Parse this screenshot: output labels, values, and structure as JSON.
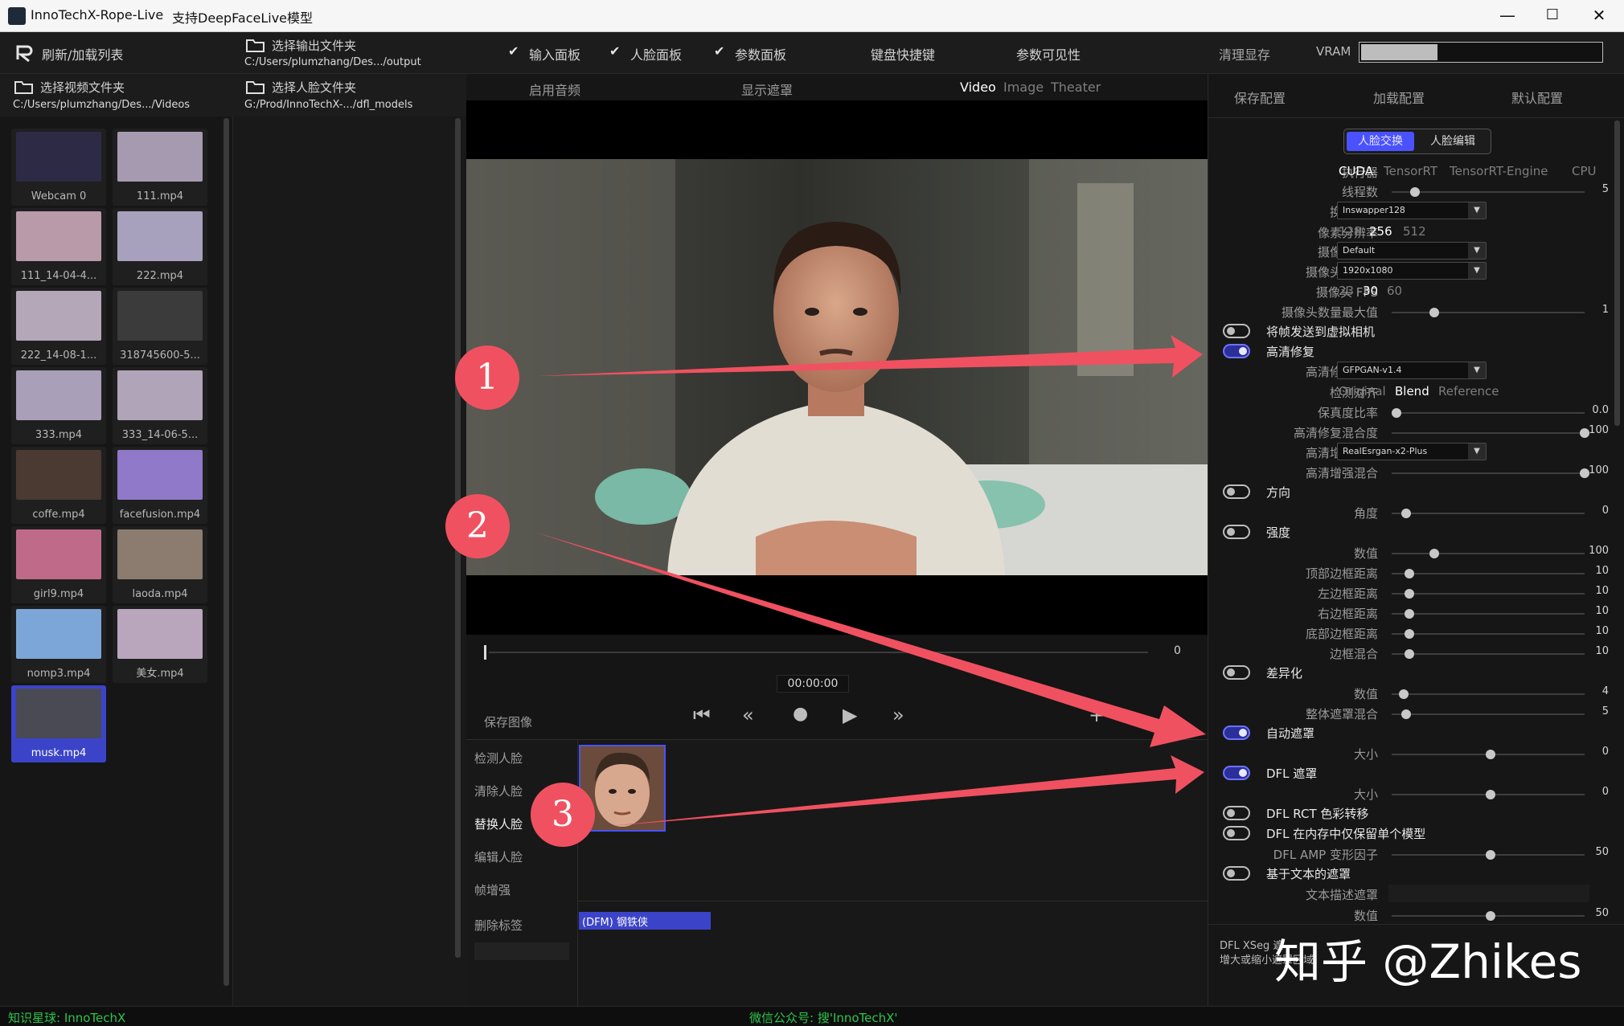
{
  "window": {
    "title": "InnoTechX-Rope-Live",
    "subtitle": "支持DeepFaceLive模型",
    "minimize": "—",
    "maximize": "☐",
    "close": "✕"
  },
  "toolbar": {
    "refresh_label": "刷新/加载列表",
    "select_output_label": "选择输出文件夹",
    "output_path": "C:/Users/plumzhang/Des.../output",
    "input_panel": "输入面板",
    "face_panel": "人脸面板",
    "param_panel": "参数面板",
    "shortcuts": "键盘快捷键",
    "param_visibility": "参数可见性",
    "clear_vram": "清理显存",
    "vram_label": "VRAM",
    "vram_fraction": 0.32
  },
  "left": {
    "select_video_label": "选择视频文件夹",
    "video_path": "C:/Users/plumzhang/Des.../Videos",
    "select_face_label": "选择人脸文件夹",
    "face_path": "G:/Prod/InnoTechX-.../dfl_models",
    "thumbnails": [
      {
        "label": "Webcam 0"
      },
      {
        "label": "111.mp4"
      },
      {
        "label": "111_14-04-4..."
      },
      {
        "label": "222.mp4"
      },
      {
        "label": "222_14-08-1..."
      },
      {
        "label": "318745600-5..."
      },
      {
        "label": "333.mp4"
      },
      {
        "label": "333_14-06-5..."
      },
      {
        "label": "coffe.mp4"
      },
      {
        "label": "facefusion.mp4"
      },
      {
        "label": "girl9.mp4"
      },
      {
        "label": "laoda.mp4"
      },
      {
        "label": "nomp3.mp4"
      },
      {
        "label": "美女.mp4"
      },
      {
        "label": "musk.mp4"
      }
    ]
  },
  "video": {
    "enable_audio": "启用音频",
    "show_mask": "显示遮罩",
    "tab_video": "Video",
    "tab_image": "Image",
    "tab_theater": "Theater",
    "frame_count": "0",
    "timecode": "00:00:00",
    "save_image": "保存图像",
    "plus": "+",
    "minus": "−"
  },
  "facepanel": {
    "detect": "检测人脸",
    "clear": "清除人脸",
    "swap": "替换人脸",
    "edit": "编辑人脸",
    "enhance": "帧增强",
    "delete_tag": "删除标签",
    "model_tag": "(DFM) 钢铁侠"
  },
  "right": {
    "save_config": "保存配置",
    "load_config": "加载配置",
    "default_config": "默认配置",
    "tab_swap": "人脸交换",
    "tab_edit": "人脸编辑",
    "executor_label": "执行器",
    "executor_options": [
      "CUDA",
      "TensorRT",
      "TensorRT-Engine",
      "CPU"
    ],
    "threads_label": "线程数",
    "threads_value": "5",
    "swap_model_label": "换脸模型",
    "swap_model_value": "Inswapper128",
    "pixel_res_label": "像素分辨率",
    "pixel_res_options": [
      "128",
      "256",
      "512"
    ],
    "cam_backend_label": "摄像头后端",
    "cam_backend_value": "Default",
    "cam_res_label": "摄像头分辨率",
    "cam_res_value": "1920x1080",
    "cam_fps_label": "摄像头 FPS",
    "cam_fps_options": [
      "23",
      "30",
      "60"
    ],
    "cam_max_label": "摄像头数量最大值",
    "cam_max_value": "1",
    "virtual_cam_label": "将帧发送到虚拟相机",
    "restore_label": "高清修复",
    "restore_type_label": "高清修复类型",
    "restore_type_value": "GFPGAN-v1.4",
    "detect_align_label": "检测对齐",
    "detect_align_options": [
      "Original",
      "Blend",
      "Reference"
    ],
    "fidelity_label": "保真度比率",
    "fidelity_value": "0.0",
    "restore_blend_label": "高清修复混合度",
    "restore_blend_value": "100",
    "enhance_type_label": "高清增强类型",
    "enhance_type_value": "RealEsrgan-x2-Plus",
    "enhance_blend_label": "高清增强混合",
    "enhance_blend_value": "100",
    "orientation_label": "方向",
    "angle_label": "角度",
    "angle_value": "0",
    "strength_label": "强度",
    "amount_label": "数值",
    "amount_value": "100",
    "top_border_label": "顶部边框距离",
    "top_border_value": "10",
    "left_border_label": "左边框距离",
    "left_border_value": "10",
    "right_border_label": "右边框距离",
    "right_border_value": "10",
    "bottom_border_label": "底部边框距离",
    "bottom_border_value": "10",
    "border_blend_label": "边框混合",
    "border_blend_value": "10",
    "diff_label": "差异化",
    "diff_amount_label": "数值",
    "diff_amount_value": "4",
    "overall_mask_label": "整体遮罩混合",
    "overall_mask_value": "5",
    "auto_mask_label": "自动遮罩",
    "auto_size_label": "大小",
    "auto_size_value": "0",
    "dfl_mask_label": "DFL 遮罩",
    "dfl_size_label": "大小",
    "dfl_size_value": "0",
    "dfl_rct_label": "DFL RCT 色彩转移",
    "dfl_keep_label": "DFL 在内存中仅保留单个模型",
    "dfl_amp_label": "DFL AMP 变形因子",
    "dfl_amp_value": "50",
    "text_mask_label": "基于文本的遮罩",
    "text_desc_label": "文本描述遮罩",
    "text_amount_label": "数值",
    "text_amount_value": "50",
    "hint_line1": "DFL XSeg 遮",
    "hint_line2": "增大或缩小遮罩区域"
  },
  "statusbar": {
    "left": "知识星球: InnoTechX",
    "center": "微信公众号: 搜'InnoTechX'"
  },
  "annotations": {
    "badge1": "1",
    "badge2": "2",
    "badge3": "3",
    "color": "#f05160"
  },
  "watermark": "知乎 @Zhikes"
}
